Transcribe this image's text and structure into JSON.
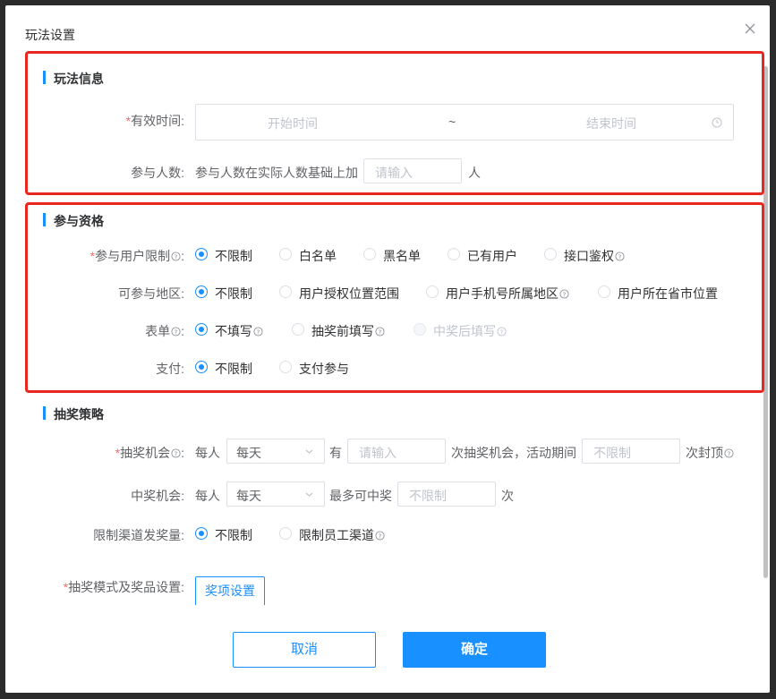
{
  "dialog": {
    "title": "玩法设置"
  },
  "info": {
    "section_title": "玩法信息",
    "valid_time": {
      "label": "有效时间:",
      "start_placeholder": "开始时间",
      "separator": "~",
      "end_placeholder": "结束时间"
    },
    "participants": {
      "label": "参与人数:",
      "prefix": "参与人数在实际人数基础上加",
      "placeholder": "请输入",
      "unit": "人"
    }
  },
  "qualification": {
    "section_title": "参与资格",
    "user_limit": {
      "label": "参与用户限制",
      "options": [
        "不限制",
        "白名单",
        "黑名单",
        "已有用户",
        "接口鉴权"
      ],
      "selected": "不限制"
    },
    "region": {
      "label": "可参与地区:",
      "options": [
        "不限制",
        "用户授权位置范围",
        "用户手机号所属地区",
        "用户所在省市位置"
      ],
      "selected": "不限制"
    },
    "form": {
      "label": "表单",
      "options": [
        "不填写",
        "抽奖前填写",
        "中奖后填写"
      ],
      "selected": "不填写"
    },
    "payment": {
      "label": "支付:",
      "options": [
        "不限制",
        "支付参与"
      ],
      "selected": "不限制"
    }
  },
  "strategy": {
    "section_title": "抽奖策略",
    "draw_chance": {
      "label": "抽奖机会",
      "prefix": "每人",
      "period": "每天",
      "mid": "有",
      "placeholder": "请输入",
      "mid2": "次抽奖机会，活动期间",
      "limit_placeholder": "不限制",
      "suffix": "次封顶"
    },
    "win_chance": {
      "label": "中奖机会:",
      "prefix": "每人",
      "period": "每天",
      "mid": "最多可中奖",
      "placeholder": "不限制",
      "suffix": "次"
    },
    "channel_limit": {
      "label": "限制渠道发奖量:",
      "options": [
        "不限制",
        "限制员工渠道"
      ],
      "selected": "不限制"
    },
    "prize_mode": {
      "label": "抽奖模式及奖品设置:",
      "button": "奖项设置"
    }
  },
  "footer": {
    "cancel": "取消",
    "confirm": "确定"
  },
  "colors": {
    "primary": "#1890ff",
    "highlight": "#e9271e",
    "required": "#f56c6c"
  }
}
